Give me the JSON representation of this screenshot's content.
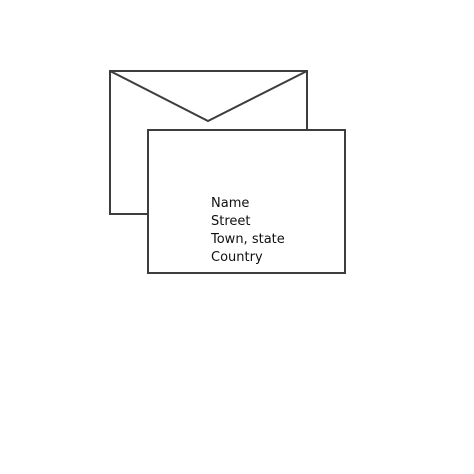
{
  "address": {
    "lines": [
      "Name",
      "Street",
      "Town, state",
      "Country"
    ]
  },
  "colors": {
    "stroke": "#3d3d3d",
    "background": "#ffffff",
    "text": "#111111"
  }
}
